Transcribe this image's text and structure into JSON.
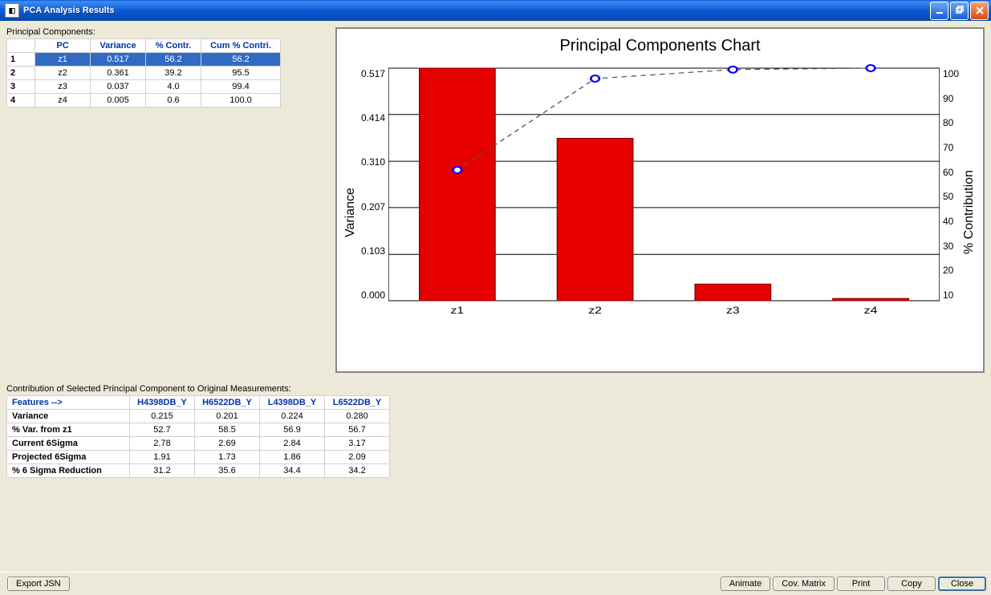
{
  "window": {
    "title": "PCA Analysis Results"
  },
  "labels": {
    "pc_section": "Principal Components:",
    "contrib_section": "Contribution of Selected Principal Component to Original Measurements:"
  },
  "pc_table": {
    "headers": {
      "pc": "PC",
      "variance": "Variance",
      "pct_contr": "% Contr.",
      "cum_contr": "Cum % Contri."
    },
    "rows": [
      {
        "n": "1",
        "pc": "z1",
        "variance": "0.517",
        "pct": "56.2",
        "cum": "56.2",
        "selected": true
      },
      {
        "n": "2",
        "pc": "z2",
        "variance": "0.361",
        "pct": "39.2",
        "cum": "95.5"
      },
      {
        "n": "3",
        "pc": "z3",
        "variance": "0.037",
        "pct": "4.0",
        "cum": "99.4"
      },
      {
        "n": "4",
        "pc": "z4",
        "variance": "0.005",
        "pct": "0.6",
        "cum": "100.0"
      }
    ]
  },
  "chart_data": {
    "type": "bar",
    "title": "Principal Components Chart",
    "y1label": "Variance",
    "y2label": "% Contribution",
    "categories": [
      "z1",
      "z2",
      "z3",
      "z4"
    ],
    "series": [
      {
        "name": "Variance",
        "axis": "y1",
        "values": [
          0.517,
          0.361,
          0.037,
          0.005
        ]
      },
      {
        "name": "Cum % Contribution",
        "axis": "y2",
        "values": [
          56.2,
          95.5,
          99.4,
          100.0
        ]
      }
    ],
    "y1_ticks": [
      "0.000",
      "0.103",
      "0.207",
      "0.310",
      "0.414",
      "0.517"
    ],
    "y1lim": [
      0,
      0.517
    ],
    "y2_ticks": [
      "10",
      "20",
      "30",
      "40",
      "50",
      "60",
      "70",
      "80",
      "90",
      "100"
    ],
    "y2lim": [
      0,
      100
    ]
  },
  "contrib_table": {
    "features_label": "Features -->",
    "columns": [
      "H4398DB_Y",
      "H6522DB_Y",
      "L4398DB_Y",
      "L6522DB_Y"
    ],
    "rows": [
      {
        "feat": "Variance",
        "vals": [
          "0.215",
          "0.201",
          "0.224",
          "0.280"
        ]
      },
      {
        "feat": "% Var. from z1",
        "vals": [
          "52.7",
          "58.5",
          "56.9",
          "56.7"
        ]
      },
      {
        "feat": "Current 6Sigma",
        "vals": [
          "2.78",
          "2.69",
          "2.84",
          "3.17"
        ]
      },
      {
        "feat": "Projected 6Sigma",
        "vals": [
          "1.91",
          "1.73",
          "1.86",
          "2.09"
        ]
      },
      {
        "feat": "% 6 Sigma Reduction",
        "vals": [
          "31.2",
          "35.6",
          "34.4",
          "34.2"
        ]
      }
    ]
  },
  "buttons": {
    "export": "Export JSN",
    "animate": "Animate",
    "cov": "Cov. Matrix",
    "print": "Print",
    "copy": "Copy",
    "close": "Close"
  }
}
